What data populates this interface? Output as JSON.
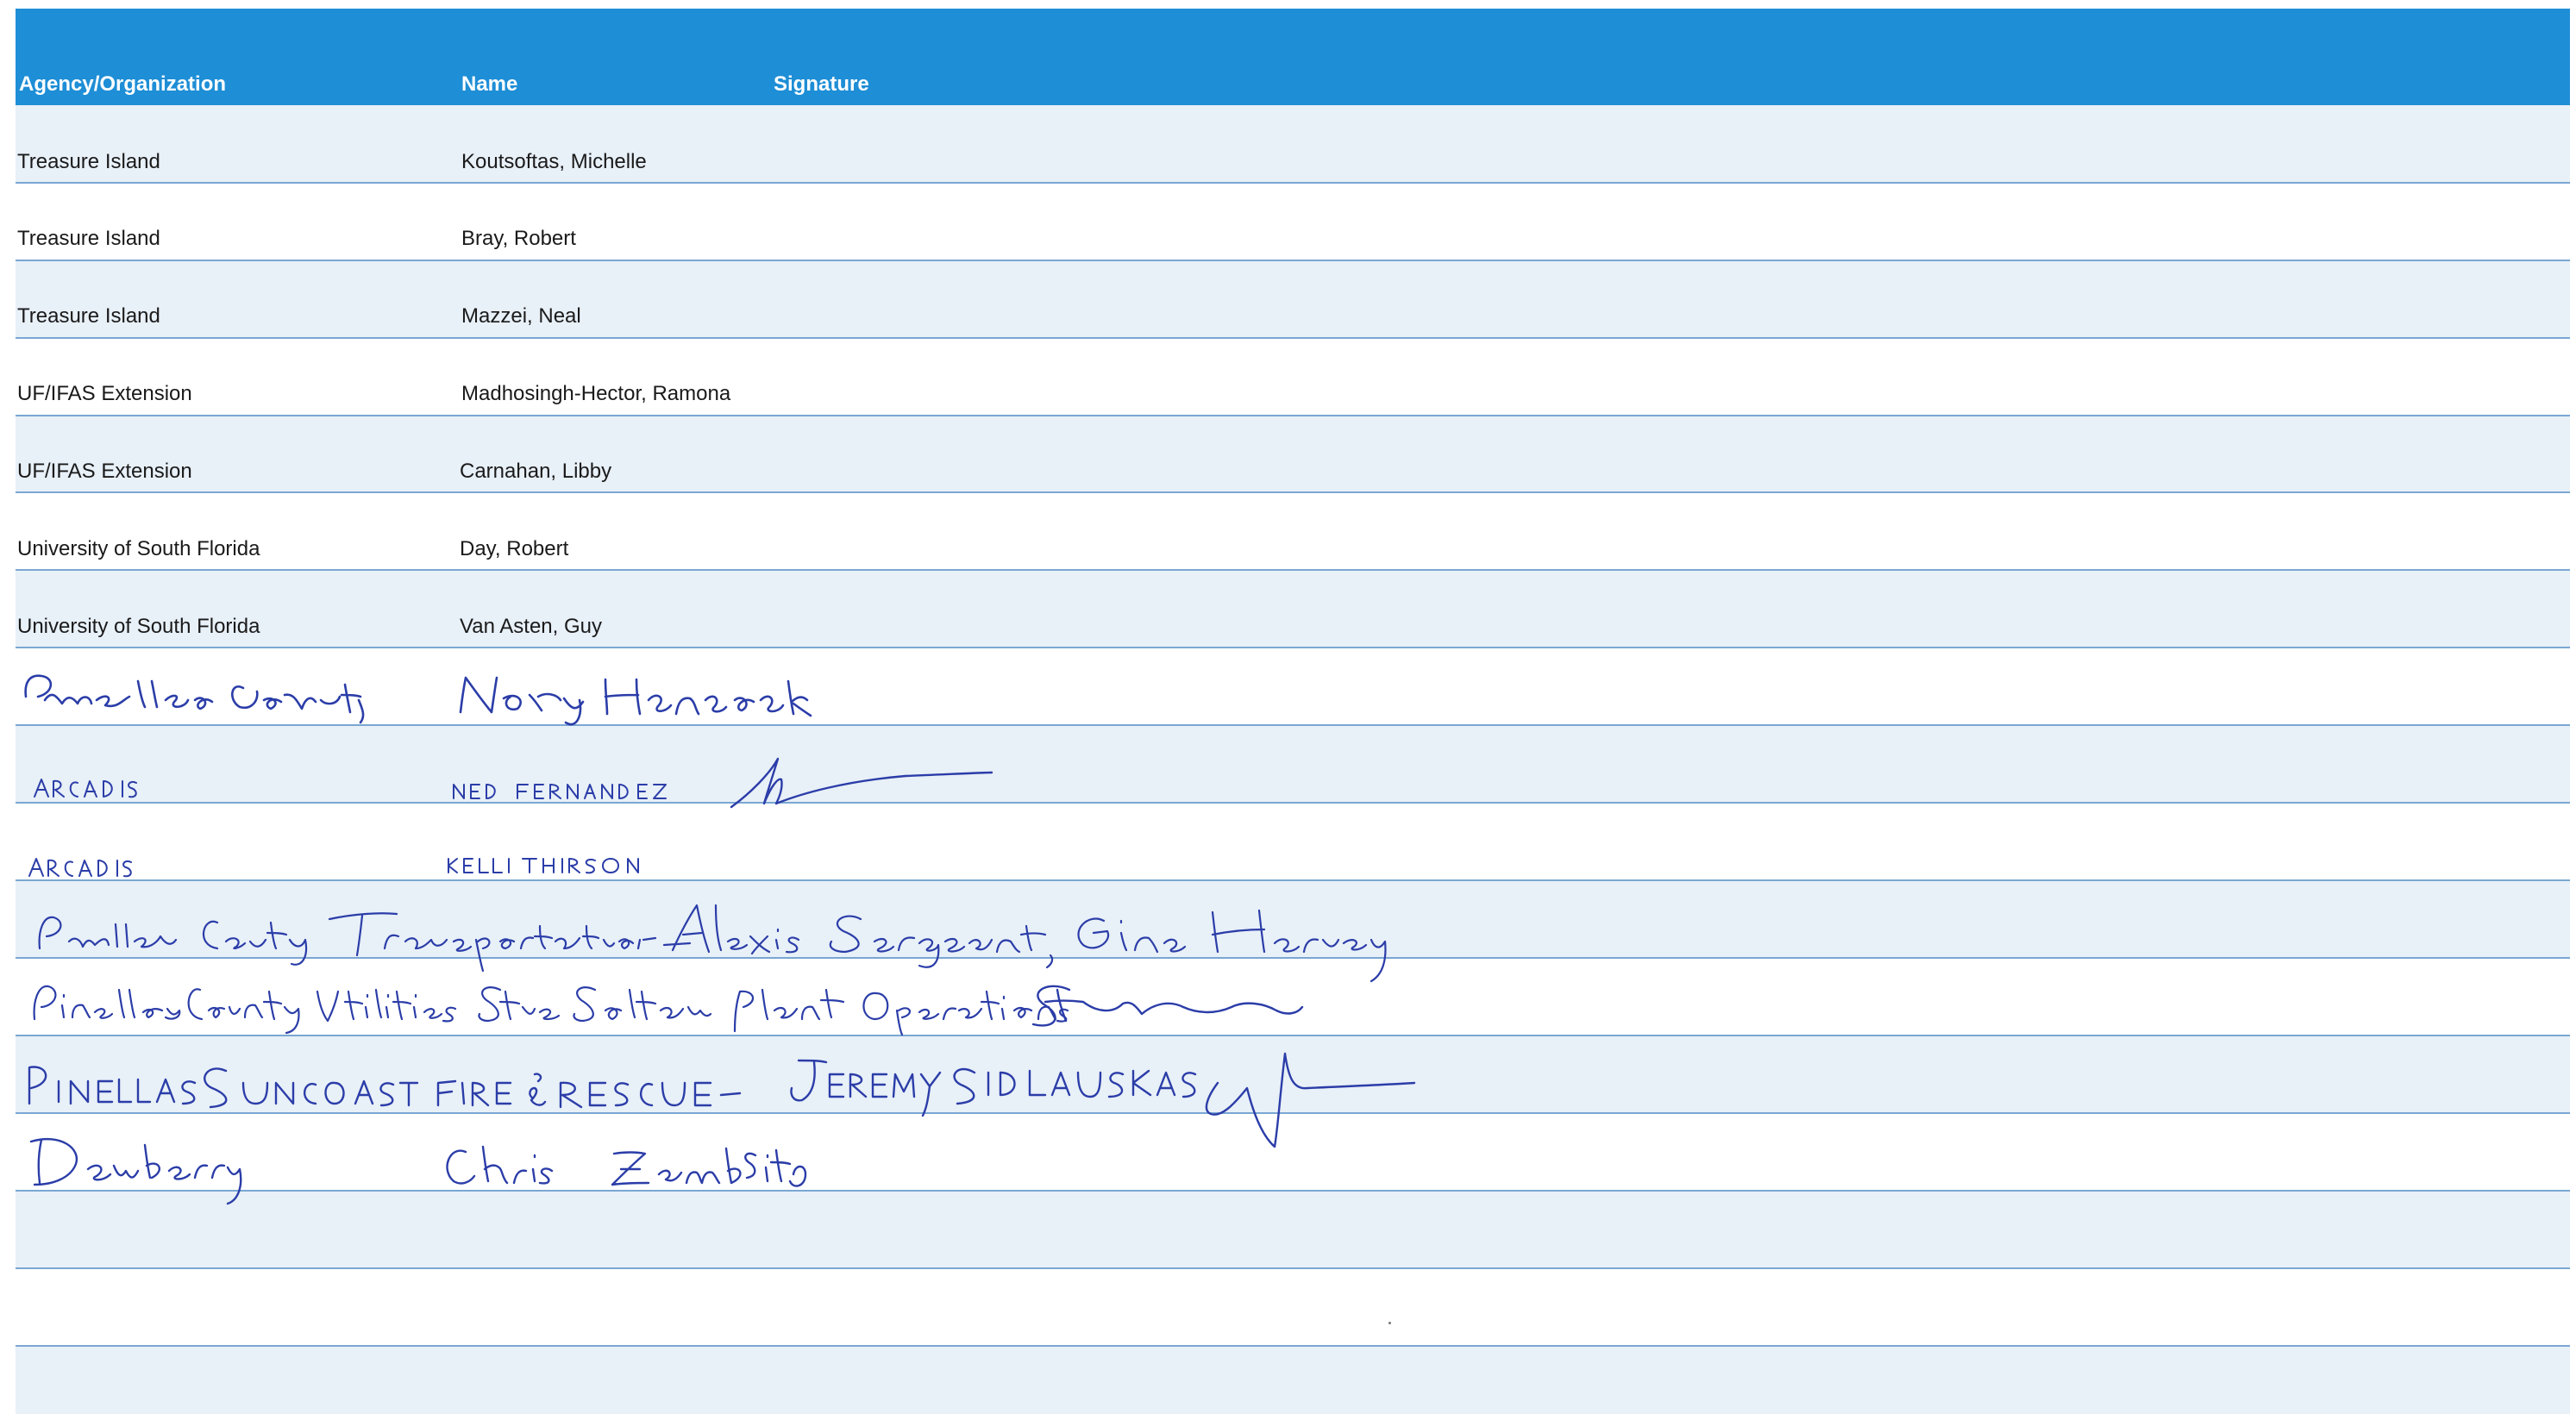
{
  "header": {
    "agency": "Agency/Organization",
    "name": "Name",
    "signature": "Signature"
  },
  "rows": [
    {
      "agency": "Treasure Island",
      "name": "Koutsoftas, Michelle"
    },
    {
      "agency": "Treasure Island",
      "name": "Bray, Robert"
    },
    {
      "agency": "Treasure Island",
      "name": "Mazzei, Neal"
    },
    {
      "agency": "UF/IFAS Extension",
      "name": "Madhosingh-Hector, Ramona"
    },
    {
      "agency": "UF/IFAS Extension",
      "name": "Carnahan, Libby"
    },
    {
      "agency": "University of South Florida",
      "name": "Day, Robert"
    },
    {
      "agency": "University of South Florida",
      "name": "Van Asten, Guy"
    }
  ],
  "handwritten": [
    {
      "agency": "Pinellas County",
      "name": "Nory Hancock"
    },
    {
      "agency": "ARCADIS",
      "name": "NED FERNANDEZ"
    },
    {
      "agency": "ARCADIS",
      "name": "KELLI THIRSON"
    },
    {
      "agency": "Pinellas County Transportation",
      "name": "Alexis Sergeant, Gina Harvey"
    },
    {
      "agency": "Pinellas County Utilities",
      "name": "Steve Soltau Plant Operations"
    },
    {
      "agency": "PINELLAS SUNCOAST FIRE & RESCUE",
      "name": "JEREMY SIDLAUSKAS"
    },
    {
      "agency": "Dewberry",
      "name": "Chris Zambito"
    }
  ],
  "colors": {
    "header": "#1e8ed6",
    "band": "#e8f0f8",
    "rule": "#7aa7d2",
    "ink": "#2b3da8"
  }
}
